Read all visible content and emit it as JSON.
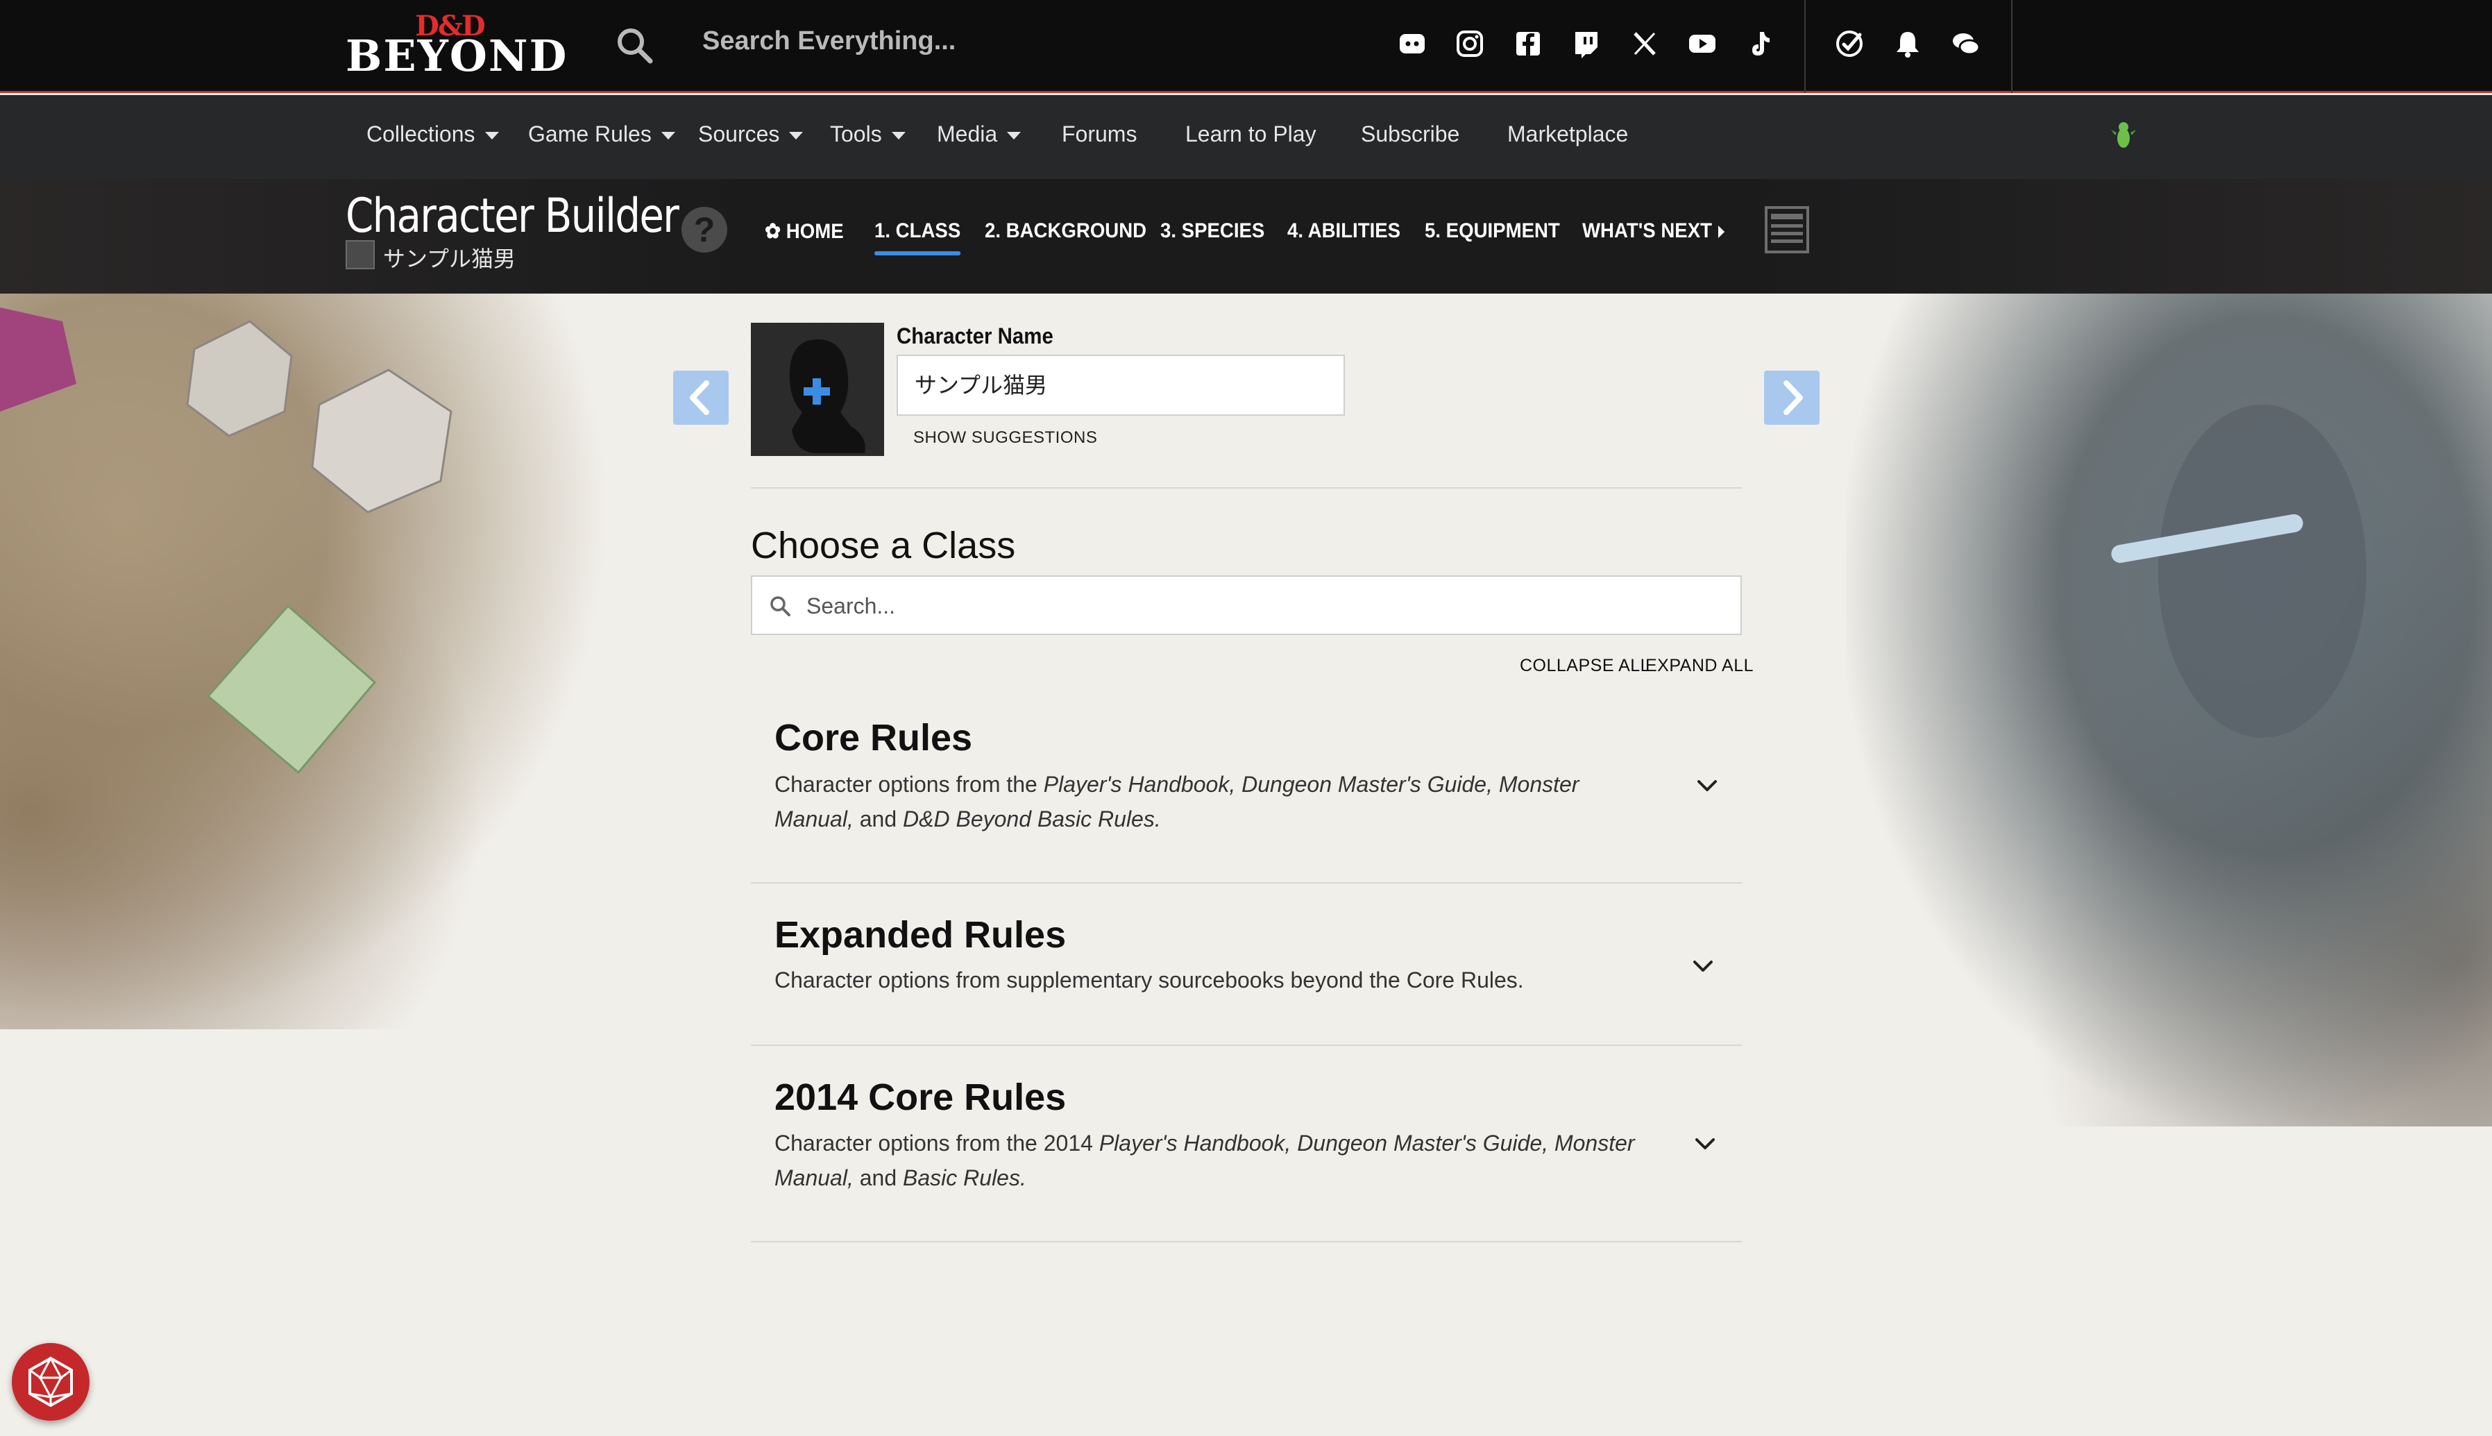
{
  "header": {
    "logo_top": "D&D",
    "logo_bottom": "BEYOND",
    "search_placeholder": "Search Everything...",
    "social_icons": [
      "discord-icon",
      "instagram-icon",
      "facebook-icon",
      "twitch-icon",
      "x-icon",
      "youtube-icon",
      "tiktok-icon"
    ],
    "utility_icons": [
      "dice-check-icon",
      "bell-icon",
      "chat-icon"
    ]
  },
  "nav": {
    "items": [
      {
        "label": "Collections",
        "dropdown": true
      },
      {
        "label": "Game Rules",
        "dropdown": true
      },
      {
        "label": "Sources",
        "dropdown": true
      },
      {
        "label": "Tools",
        "dropdown": true
      },
      {
        "label": "Media",
        "dropdown": true
      },
      {
        "label": "Forums",
        "dropdown": false
      },
      {
        "label": "Learn to Play",
        "dropdown": false
      },
      {
        "label": "Subscribe",
        "dropdown": false
      },
      {
        "label": "Marketplace",
        "dropdown": false
      }
    ]
  },
  "builder": {
    "title": "Character Builder",
    "character_subtitle": "サンプル猫男",
    "help_label": "?",
    "steps": [
      {
        "label": "HOME",
        "icon": "gear-icon"
      },
      {
        "label": "1. CLASS",
        "active": true
      },
      {
        "label": "2. BACKGROUND"
      },
      {
        "label": "3. SPECIES"
      },
      {
        "label": "4. ABILITIES"
      },
      {
        "label": "5. EQUIPMENT"
      },
      {
        "label": "WHAT'S NEXT"
      }
    ]
  },
  "character": {
    "name_label": "Character Name",
    "name_value": "サンプル猫男",
    "show_suggestions": "SHOW SUGGESTIONS"
  },
  "class_picker": {
    "title": "Choose a Class",
    "search_placeholder": "Search...",
    "collapse_all": "COLLAPSE ALL",
    "expand_all": "EXPAND ALL",
    "groups": [
      {
        "title": "Core Rules",
        "desc_parts": [
          {
            "t": "Character options from the "
          },
          {
            "t": "Player's Handbook, Dungeon Master's Guide, Monster Manual,",
            "i": true
          },
          {
            "t": " and "
          },
          {
            "t": "D&D Beyond Basic Rules.",
            "i": true
          }
        ]
      },
      {
        "title": "Expanded Rules",
        "desc_parts": [
          {
            "t": "Character options from supplementary sourcebooks beyond the Core Rules."
          }
        ]
      },
      {
        "title": "2014 Core Rules",
        "desc_parts": [
          {
            "t": "Character options from the 2014 "
          },
          {
            "t": "Player's Handbook, Dungeon Master's Guide, Monster Manual,",
            "i": true
          },
          {
            "t": " and "
          },
          {
            "t": "Basic Rules.",
            "i": true
          }
        ]
      }
    ]
  },
  "colors": {
    "header_bg": "#0d0d0e",
    "accent_red": "#c53131",
    "nav_bg": "#26282a",
    "active_step": "#3b8de4",
    "arrow_btn": "#a8c8ee",
    "portrait_plus": "#3b8de4",
    "dice_button": "#c4282a"
  }
}
